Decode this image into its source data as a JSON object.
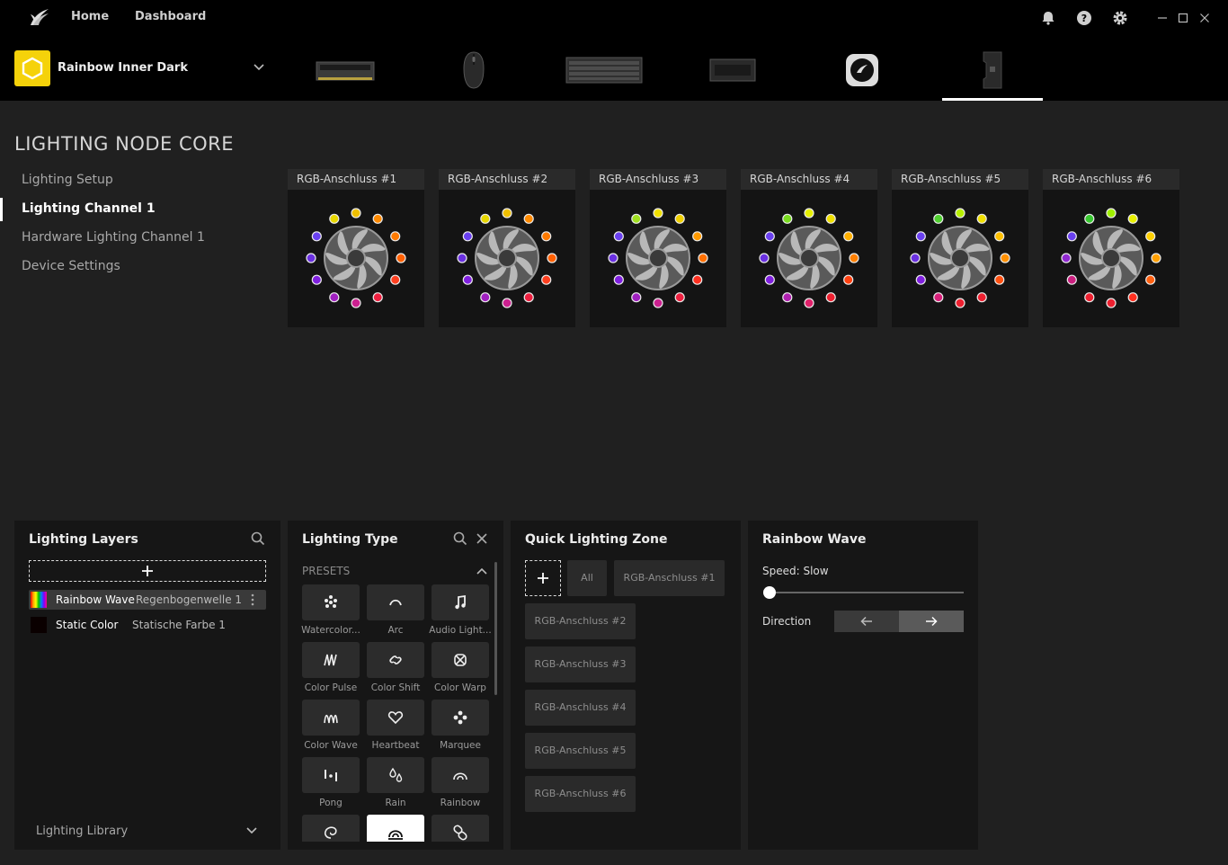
{
  "titlebar": {
    "nav": [
      "Home",
      "Dashboard"
    ],
    "icons": [
      "corsair-logo-icon",
      "bell-icon",
      "help-icon",
      "gear-icon",
      "minimize-icon",
      "maximize-icon",
      "close-icon"
    ]
  },
  "profile": {
    "name": "Rainbow Inner Dark",
    "color": "#f5d20a"
  },
  "devices": [
    "ram-device",
    "mouse-device",
    "keyboard-device",
    "hub-device",
    "cooler-device",
    "lighting-node-device"
  ],
  "page": {
    "title": "LIGHTING NODE CORE",
    "nav": [
      "Lighting Setup",
      "Lighting Channel 1",
      "Hardware Lighting Channel 1",
      "Device Settings"
    ],
    "active_nav": "Lighting Channel 1"
  },
  "ports": [
    {
      "label": "RGB-Anschluss #1"
    },
    {
      "label": "RGB-Anschluss #2"
    },
    {
      "label": "RGB-Anschluss #3"
    },
    {
      "label": "RGB-Anschluss #4"
    },
    {
      "label": "RGB-Anschluss #5"
    },
    {
      "label": "RGB-Anschluss #6"
    }
  ],
  "led_colors": [
    [
      "#e8d800",
      "#f0c000",
      "#ff8a00",
      "#ff7a00",
      "#ff6000",
      "#ff4020",
      "#ee2040",
      "#cc2090",
      "#a020c0",
      "#8020e0",
      "#6a30e0",
      "#6a40f0"
    ],
    [
      "#e8d800",
      "#f0c000",
      "#ff8a00",
      "#ff7a00",
      "#ff6000",
      "#ff4020",
      "#ee2040",
      "#cc2090",
      "#a020c0",
      "#8020e0",
      "#6a30e0",
      "#6a40f0"
    ],
    [
      "#a0e020",
      "#f0e000",
      "#f0d000",
      "#ff9a00",
      "#ff7000",
      "#ff3020",
      "#ee2040",
      "#cc2090",
      "#a020c0",
      "#8020e0",
      "#6a30e0",
      "#6a40f0"
    ],
    [
      "#7adc20",
      "#e6f000",
      "#f0e000",
      "#ffb000",
      "#ff8000",
      "#ff4010",
      "#ee2030",
      "#e0206a",
      "#b020b0",
      "#8020e0",
      "#6a30e0",
      "#6a40f0"
    ],
    [
      "#50d030",
      "#b8f000",
      "#f0e000",
      "#ffc000",
      "#ff9000",
      "#ff5010",
      "#ee2030",
      "#ee2030",
      "#d8207a",
      "#8020e0",
      "#6a30e0",
      "#6a40f0"
    ],
    [
      "#38c830",
      "#a0f000",
      "#e8f000",
      "#ffd000",
      "#ffa000",
      "#ff6010",
      "#ff3020",
      "#ee2030",
      "#ee2030",
      "#cc2080",
      "#9028d0",
      "#6a40f0"
    ]
  ],
  "layers_panel": {
    "title": "Lighting Layers",
    "layers": [
      {
        "type": "Rainbow Wave",
        "name": "Regenbogenwelle 1"
      },
      {
        "type": "Static Color",
        "name": "Statische Farbe 1"
      }
    ],
    "library": "Lighting Library"
  },
  "type_panel": {
    "title": "Lighting Type",
    "section": "PRESETS",
    "items": [
      "Watercolor...",
      "Arc",
      "Audio Light...",
      "Color Pulse",
      "Color Shift",
      "Color Warp",
      "Color Wave",
      "Heartbeat",
      "Marquee",
      "Pong",
      "Rain",
      "Rainbow"
    ],
    "icons": [
      "watercolor-icon",
      "arc-icon",
      "music-note-icon",
      "color-pulse-icon",
      "link-icon",
      "color-warp-icon",
      "color-wave-icon",
      "heart-icon",
      "marquee-icon",
      "pong-icon",
      "rain-icon",
      "rainbow-icon",
      "spiral-icon",
      "rainbow-wave-icon",
      "chain-icon"
    ]
  },
  "zone_panel": {
    "title": "Quick Lighting Zone",
    "all": "All",
    "zones": [
      "RGB-Anschluss #1",
      "RGB-Anschluss #2",
      "RGB-Anschluss #3",
      "RGB-Anschluss #4",
      "RGB-Anschluss #5",
      "RGB-Anschluss #6"
    ]
  },
  "effect_panel": {
    "title": "Rainbow Wave",
    "speed": "Speed: Slow",
    "speed_level": 0,
    "direction_label": "Direction",
    "direction": "right"
  }
}
